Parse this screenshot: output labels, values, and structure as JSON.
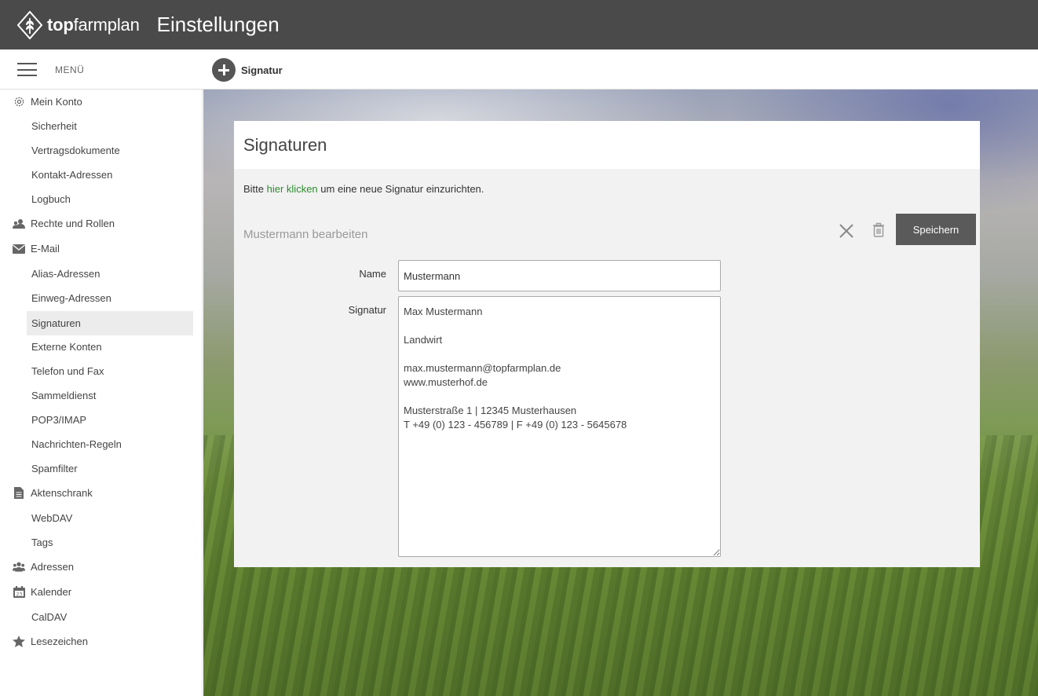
{
  "header": {
    "logo_bold": "top",
    "logo_regular": "farmplan",
    "title": "Einstellungen"
  },
  "toolbar": {
    "menu_label": "MENÜ",
    "add_label": "Signatur"
  },
  "sidebar": {
    "items": [
      {
        "label": "Mein Konto",
        "level": "top",
        "icon": "gear-icon"
      },
      {
        "label": "Sicherheit",
        "level": "sub"
      },
      {
        "label": "Vertragsdokumente",
        "level": "sub"
      },
      {
        "label": "Kontakt-Adressen",
        "level": "sub"
      },
      {
        "label": "Logbuch",
        "level": "sub"
      },
      {
        "label": "Rechte und Rollen",
        "level": "top",
        "icon": "users-icon"
      },
      {
        "label": "E-Mail",
        "level": "top",
        "icon": "envelope-icon"
      },
      {
        "label": "Alias-Adressen",
        "level": "sub"
      },
      {
        "label": "Einweg-Adressen",
        "level": "sub"
      },
      {
        "label": "Signaturen",
        "level": "sub",
        "active": true
      },
      {
        "label": "Externe Konten",
        "level": "sub"
      },
      {
        "label": "Telefon und Fax",
        "level": "sub"
      },
      {
        "label": "Sammeldienst",
        "level": "sub"
      },
      {
        "label": "POP3/IMAP",
        "level": "sub"
      },
      {
        "label": "Nachrichten-Regeln",
        "level": "sub"
      },
      {
        "label": "Spamfilter",
        "level": "sub"
      },
      {
        "label": "Aktenschrank",
        "level": "top",
        "icon": "document-icon"
      },
      {
        "label": "WebDAV",
        "level": "sub"
      },
      {
        "label": "Tags",
        "level": "sub"
      },
      {
        "label": "Adressen",
        "level": "top",
        "icon": "contacts-icon"
      },
      {
        "label": "Kalender",
        "level": "top",
        "icon": "calendar-icon"
      },
      {
        "label": "CalDAV",
        "level": "sub"
      },
      {
        "label": "Lesezeichen",
        "level": "top",
        "icon": "star-icon"
      }
    ]
  },
  "panel": {
    "title": "Signaturen",
    "hint_prefix": "Bitte ",
    "hint_link": "hier klicken",
    "hint_suffix": " um eine neue Signatur einzurichten.",
    "edit_title": "Mustermann bearbeiten",
    "save_label": "Speichern",
    "name_label": "Name",
    "name_value": "Mustermann",
    "signature_label": "Signatur",
    "signature_value": "Max Mustermann\n\nLandwirt\n\nmax.mustermann@topfarmplan.de\nwww.musterhof.de\n\nMusterstraße 1 | 12345 Musterhausen\nT +49 (0) 123 - 456789 | F +49 (0) 123 - 5645678"
  },
  "colors": {
    "header_bg": "#4a4a4a",
    "link_green": "#2e8b2e",
    "save_button": "#5a5a5a",
    "active_item_bg": "#ececec"
  }
}
